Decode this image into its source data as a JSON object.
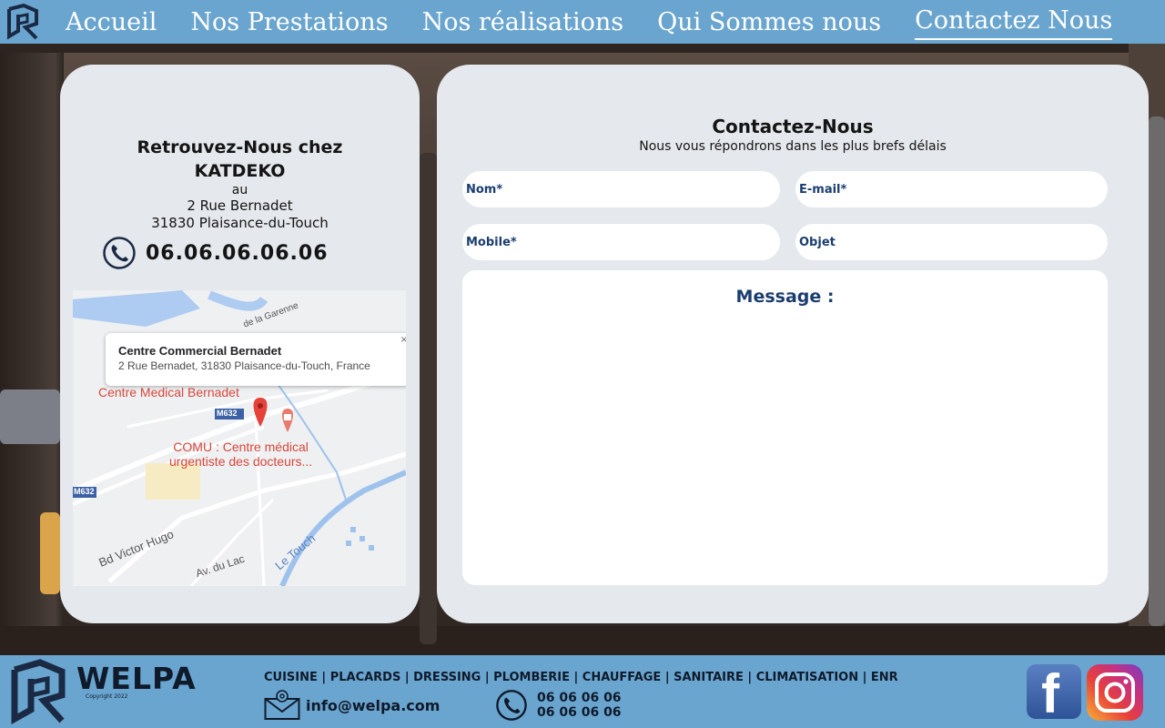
{
  "nav": {
    "items": [
      {
        "label": "Accueil"
      },
      {
        "label": "Nos Prestations"
      },
      {
        "label": "Nos réalisations"
      },
      {
        "label": "Qui Sommes nous"
      },
      {
        "label": "Contactez Nous"
      }
    ],
    "active_index": 4
  },
  "address": {
    "title_line1": "Retrouvez-Nous chez",
    "title_line2": "KATDEKO",
    "au": "au",
    "street": "2 Rue Bernadet",
    "city": "31830 Plaisance-du-Touch",
    "phone": "06.06.06.06.06"
  },
  "map": {
    "popup_title": "Centre Commercial Bernadet",
    "popup_address": "2 Rue Bernadet, 31830 Plaisance-du-Touch, France",
    "popup_close": "×",
    "place1": "Centre Medical Bernadet",
    "place2_line1": "COMU : Centre médical",
    "place2_line2": "urgentiste des docteurs...",
    "road_m632": "M632",
    "road_m632_b": "M632",
    "road_victor_hugo": "Bd Victor Hugo",
    "road_lac": "Av. du Lac",
    "river": "Le Touch",
    "road_garenne": "de la Garenne"
  },
  "form": {
    "title": "Contactez-Nous",
    "subtitle": "Nous vous répondrons dans les plus brefs délais",
    "name_placeholder": "Nom*",
    "email_placeholder": "E-mail*",
    "mobile_placeholder": "Mobile*",
    "subject_placeholder": "Objet",
    "message_label": "Message :"
  },
  "footer": {
    "brand": "WELPA",
    "copyright": "Copyright 2022",
    "services": "CUISINE | PLACARDS | DRESSING | PLOMBERIE | CHAUFFAGE | SANITAIRE | CLIMATISATION | ENR",
    "email": "info@welpa.com",
    "phone1": "06 06 06 06",
    "phone2": "06 06 06 06"
  },
  "colors": {
    "nav_bg": "#6aa5cf",
    "card_bg": "#e5e8ec",
    "accent": "#1b3d6e"
  },
  "icons": {
    "logo": "welpa-logo-icon",
    "phone": "phone-icon",
    "email": "email-icon",
    "facebook": "facebook-icon",
    "instagram": "instagram-icon"
  }
}
